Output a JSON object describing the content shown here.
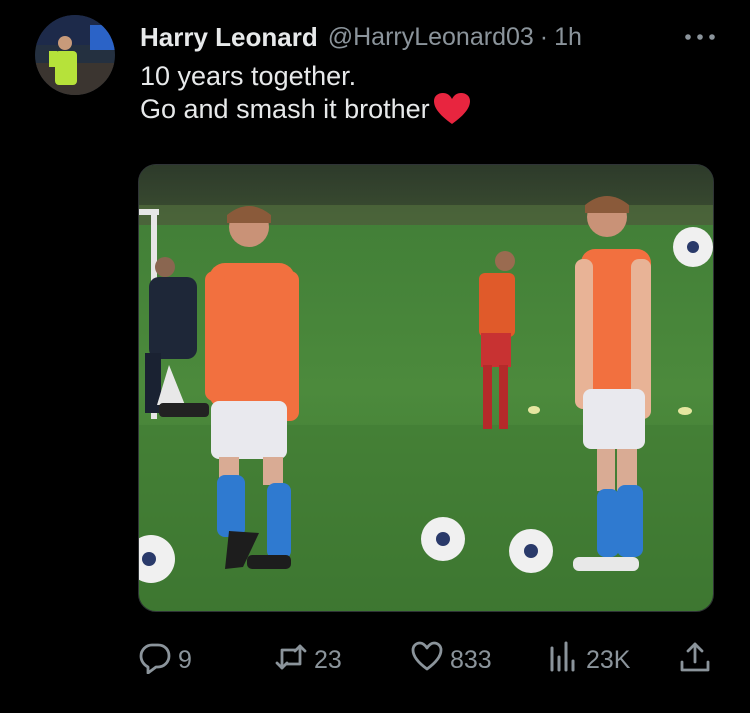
{
  "user": {
    "display_name": "Harry Leonard",
    "handle": "@HarryLeonard03",
    "separator": "·",
    "time": "1h"
  },
  "post": {
    "line1": "10 years together.",
    "line2": "Go and smash it brother"
  },
  "actions": {
    "replies": "9",
    "reposts": "23",
    "likes": "833",
    "views": "23K"
  },
  "icons": {
    "more": "more-horizontal-icon",
    "reply": "reply-icon",
    "repost": "repost-icon",
    "like": "heart-icon",
    "views": "views-chart-icon",
    "share": "share-icon",
    "emoji": "red-heart-emoji"
  },
  "colors": {
    "background": "#000000",
    "text": "#e7e9ea",
    "secondary": "#8b949b",
    "heart_emoji": "#e8253f"
  }
}
